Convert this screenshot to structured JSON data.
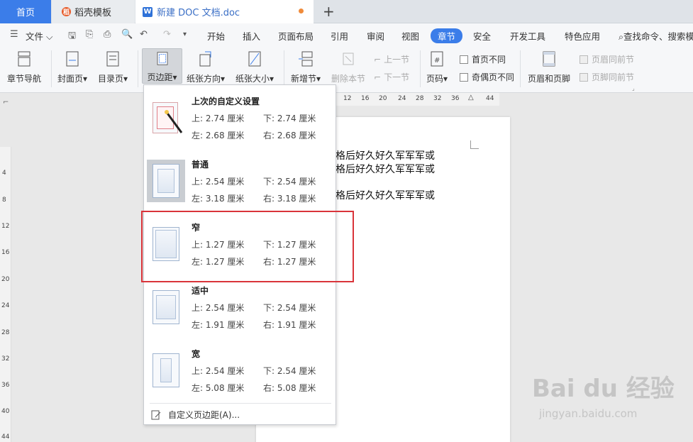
{
  "tabs": {
    "home": "首页",
    "template": "稻壳模板",
    "doc": "新建 DOC 文档.doc",
    "new_tab": "+"
  },
  "menubar": {
    "file": "文件",
    "items": [
      "开始",
      "插入",
      "页面布局",
      "引用",
      "审阅",
      "视图",
      "章节",
      "安全",
      "开发工具",
      "特色应用"
    ],
    "active": "章节",
    "search": "查找命令、搜索模"
  },
  "ribbon": {
    "chapter_nav": "章节导航",
    "cover": "封面页",
    "toc": "目录页",
    "margins": "页边距",
    "orientation": "纸张方向",
    "size": "纸张大小",
    "new_section": "新增节",
    "delete_section": "删除本节",
    "prev_section": "上一节",
    "next_section": "下一节",
    "page_number": "页码",
    "first_page_diff": "首页不同",
    "odd_even_diff": "奇偶页不同",
    "header_footer": "页眉和页脚",
    "header_same": "页眉同前节",
    "footer_same": "页脚同前节"
  },
  "ruler_top": [
    "12",
    "16",
    "20",
    "24",
    "28",
    "32",
    "36",
    "44"
  ],
  "ruler_left": [
    "4",
    "8",
    "12",
    "16",
    "20",
    "24",
    "28",
    "32",
    "36",
    "40",
    "44"
  ],
  "document": {
    "lines": [
      "格后好久好久军军军或",
      "格后好久好久军军军或",
      "格后好久好久军军军或"
    ]
  },
  "margin_presets": [
    {
      "title": "上次的自定义设置",
      "top": "上: 2.74 厘米",
      "bottom": "下: 2.74 厘米",
      "left": "左: 2.68 厘米",
      "right": "右: 2.68 厘米"
    },
    {
      "title": "普通",
      "top": "上: 2.54 厘米",
      "bottom": "下: 2.54 厘米",
      "left": "左: 3.18 厘米",
      "right": "右: 3.18 厘米"
    },
    {
      "title": "窄",
      "top": "上: 1.27 厘米",
      "bottom": "下: 1.27 厘米",
      "left": "左: 1.27 厘米",
      "right": "右: 1.27 厘米"
    },
    {
      "title": "适中",
      "top": "上: 2.54 厘米",
      "bottom": "下: 2.54 厘米",
      "left": "左: 1.91 厘米",
      "right": "右: 1.91 厘米"
    },
    {
      "title": "宽",
      "top": "上: 2.54 厘米",
      "bottom": "下: 2.54 厘米",
      "left": "左: 5.08 厘米",
      "right": "右: 5.08 厘米"
    }
  ],
  "custom_margin": "自定义页边距(A)...",
  "watermark": {
    "logo": "Bai du 经验",
    "url": "jingyan.baidu.com"
  },
  "colors": {
    "accent": "#3b7de9",
    "highlight_box": "#d9343a"
  }
}
